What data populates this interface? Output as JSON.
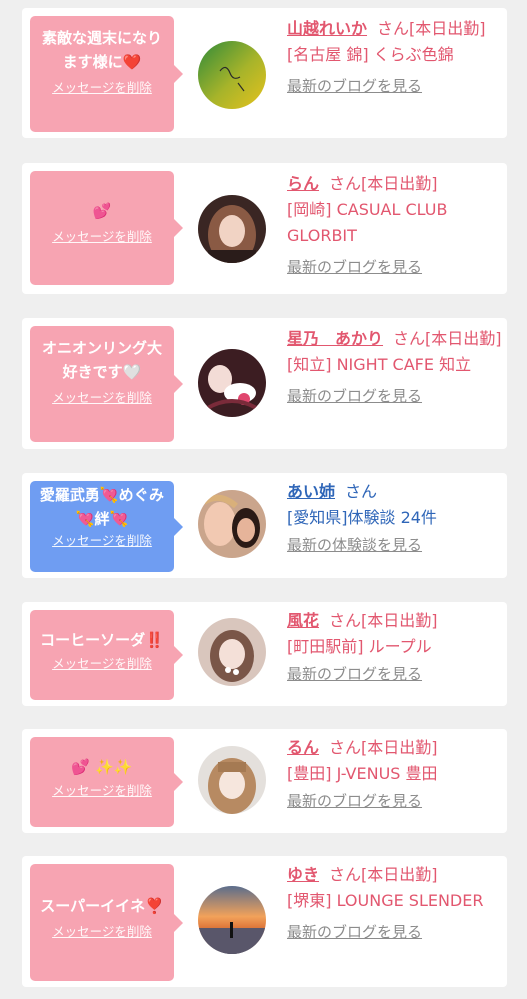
{
  "delete_label": "メッセージを削除",
  "colors": {
    "pink_bubble": "#f7a4b2",
    "blue_bubble": "#6f9df2",
    "pink_text": "#e2576f",
    "blue_text": "#2f66b8"
  },
  "cards": [
    {
      "message": "素敵な週末になります様に❤️",
      "name": "山越れいか",
      "suffix": "さん[本日出勤]",
      "shop": "[名古屋 錦] くらぶ色錦",
      "link": "最新のブログを見る",
      "theme": "pink"
    },
    {
      "message": "💕",
      "name": "らん",
      "suffix": "さん[本日出勤]",
      "shop": "[岡崎] CASUAL CLUB GLORBIT",
      "link": "最新のブログを見る",
      "theme": "pink"
    },
    {
      "message": "オニオンリング大好きです🤍",
      "name": "星乃　あかり",
      "suffix": "さん[本日出勤]",
      "shop": "[知立] NIGHT CAFE 知立",
      "link": "最新のブログを見る",
      "theme": "pink"
    },
    {
      "message": "愛羅武勇💘めぐみ💘絆💘",
      "name": "あい姉",
      "suffix": "さん",
      "shop": "[愛知県]体験談 24件",
      "link": "最新の体験談を見る",
      "theme": "blue"
    },
    {
      "message": "コーヒーソーダ‼️",
      "name": "風花",
      "suffix": "さん[本日出勤]",
      "shop": "[町田駅前] ループル",
      "link": "最新のブログを見る",
      "theme": "pink"
    },
    {
      "message": "💕 ✨✨",
      "name": "るん",
      "suffix": "さん[本日出勤]",
      "shop": "[豊田] J-VENUS 豊田",
      "link": "最新のブログを見る",
      "theme": "pink"
    },
    {
      "message": "スーパーイイネ❣️",
      "name": "ゆき",
      "suffix": "さん[本日出勤]",
      "shop": "[堺東] LOUNGE SLENDER",
      "link": "最新のブログを見る",
      "theme": "pink"
    }
  ]
}
